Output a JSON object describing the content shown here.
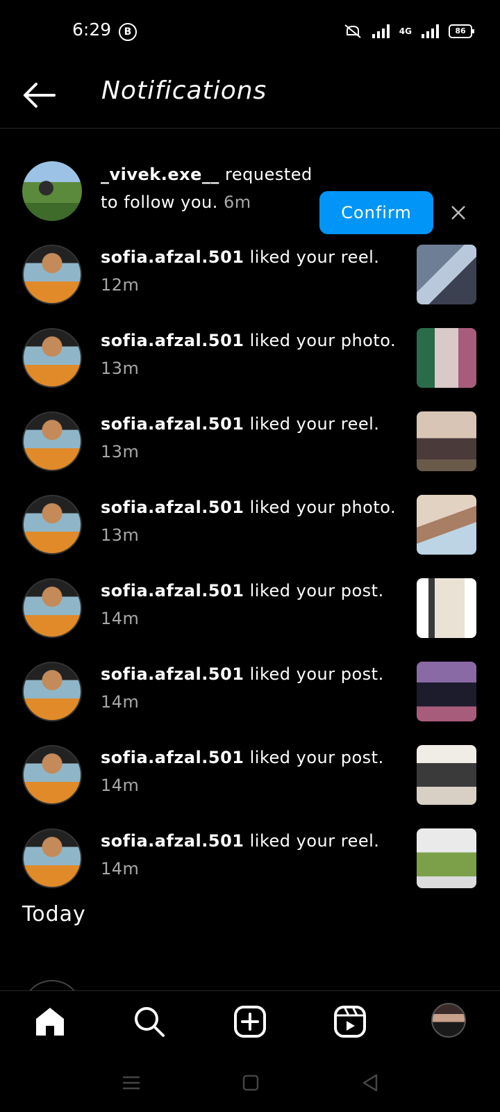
{
  "status_bar": {
    "time": "6:29",
    "b_badge": "B",
    "network": "4G",
    "battery": "86"
  },
  "header": {
    "title": "Notifications"
  },
  "notifications": {
    "follow_request": {
      "username": "_vivek.exe__",
      "text_line1": " requested",
      "text_line2": "to follow you.",
      "time": "6m",
      "confirm_label": "Confirm"
    },
    "items": [
      {
        "username": "sofia.afzal.501",
        "action": " liked your reel.",
        "time": "12m"
      },
      {
        "username": "sofia.afzal.501",
        "action": " liked your photo.",
        "time": "13m"
      },
      {
        "username": "sofia.afzal.501",
        "action": " liked your reel.",
        "time": "13m"
      },
      {
        "username": "sofia.afzal.501",
        "action": " liked your photo.",
        "time": "13m"
      },
      {
        "username": "sofia.afzal.501",
        "action": " liked your post.",
        "time": "14m"
      },
      {
        "username": "sofia.afzal.501",
        "action": " liked your post.",
        "time": "14m"
      },
      {
        "username": "sofia.afzal.501",
        "action": " liked your post.",
        "time": "14m"
      },
      {
        "username": "sofia.afzal.501",
        "action": " liked your reel.",
        "time": "14m"
      }
    ],
    "section_today": "Today"
  },
  "tabbar": {
    "tabs": [
      "home-icon",
      "search-icon",
      "create-icon",
      "reels-icon",
      "profile-avatar"
    ]
  },
  "colors": {
    "background": "#000000",
    "accent": "#0095f6",
    "secondary_text": "#a8a8a8"
  }
}
